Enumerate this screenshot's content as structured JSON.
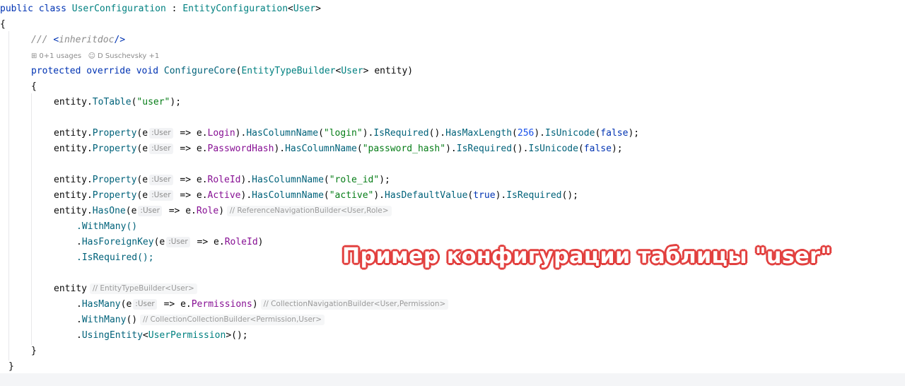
{
  "code": {
    "class_decl": {
      "kw_public": "public",
      "kw_class": "class",
      "class_name": "UserConfiguration",
      "colon": " : ",
      "base_name": "EntityConfiguration",
      "lt": "<",
      "generic": "User",
      "gt": ">"
    },
    "open_brace": "{",
    "close_brace": "}",
    "doc_comment": {
      "slashes": "/// ",
      "tag_open": "<",
      "tag_name": "inheritdoc",
      "tag_close": "/>"
    },
    "usages": {
      "usages_text": "0+1 usages",
      "author_text": "D Suschevsky +1"
    },
    "method_decl": {
      "kw_protected": "protected",
      "kw_override": "override",
      "kw_void": "void",
      "name": "ConfigureCore",
      "param_type": "EntityTypeBuilder",
      "param_generic": "User",
      "param_name": "entity"
    },
    "hint_user": ":User",
    "lines": {
      "to_table": {
        "obj": "entity",
        "method": "ToTable",
        "arg": "\"user\"",
        "end": ");"
      },
      "login": {
        "prop": "Login",
        "col": "\"login\"",
        "max_len": "256",
        "bool": "false"
      },
      "password": {
        "prop": "PasswordHash",
        "col": "\"password_hash\"",
        "bool": "false"
      },
      "role_id": {
        "prop": "RoleId",
        "col": "\"role_id\""
      },
      "active": {
        "prop": "Active",
        "col": "\"active\"",
        "default": "true"
      },
      "has_one": {
        "prop": "Role",
        "comment": "// ReferenceNavigationBuilder<User,Role>"
      },
      "with_many_1": ".WithMany()",
      "has_fk": {
        "prop": "RoleId"
      },
      "is_required": ".IsRequired();",
      "entity_stmt": {
        "obj": "entity",
        "comment": "// EntityTypeBuilder<User>"
      },
      "has_many": {
        "prop": "Permissions",
        "comment": "// CollectionNavigationBuilder<User,Permission>"
      },
      "with_many_2": {
        "comment": "// CollectionCollectionBuilder<Permission,User>"
      },
      "using_entity": {
        "generic": "UserPermission"
      }
    },
    "tokens": {
      "entity": "entity",
      "property": "Property",
      "e_param": "(e",
      "arrow": " => e.",
      "has_column_name": "HasColumnName",
      "is_required": "IsRequired",
      "has_max_length": "HasMaxLength",
      "is_unicode": "IsUnicode",
      "has_default_value": "HasDefaultValue",
      "has_one": "HasOne",
      "with_many": "WithMany",
      "has_foreign_key": "HasForeignKey",
      "has_many": "HasMany",
      "using_entity": "UsingEntity"
    }
  },
  "overlay": {
    "caption": "Пример конфигурации таблицы \"user\""
  }
}
